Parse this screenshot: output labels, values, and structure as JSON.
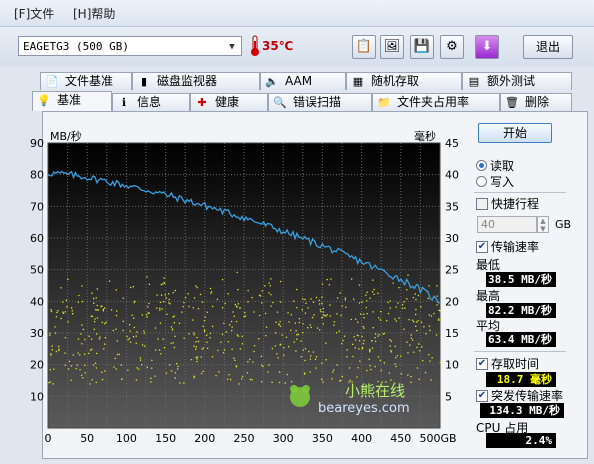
{
  "menu": {
    "file": "[F]文件",
    "help": "[H]帮助"
  },
  "drive": {
    "selected": "EAGETG3 (500 GB)"
  },
  "temperature": "35℃",
  "toolbar": {
    "exit_label": "退出"
  },
  "tabs_top": [
    {
      "label": "文件基准",
      "icon": "file-benchmark-icon"
    },
    {
      "label": "磁盘监视器",
      "icon": "disk-monitor-icon"
    },
    {
      "label": "AAM",
      "icon": "speaker-icon"
    },
    {
      "label": "随机存取",
      "icon": "random-access-icon"
    },
    {
      "label": "额外测试",
      "icon": "extra-tests-icon"
    }
  ],
  "tabs_bottom": [
    {
      "label": "基准",
      "icon": "lightbulb-icon"
    },
    {
      "label": "信息",
      "icon": "info-icon"
    },
    {
      "label": "健康",
      "icon": "health-cross-icon"
    },
    {
      "label": "错误扫描",
      "icon": "magnifier-icon"
    },
    {
      "label": "文件夹占用率",
      "icon": "folder-icon"
    },
    {
      "label": "删除",
      "icon": "trash-icon"
    }
  ],
  "chart_data": {
    "type": "line",
    "y_left_label": "MB/秒",
    "y_right_label": "毫秒",
    "ylim_left": [
      0,
      90
    ],
    "ylim_right": [
      0,
      45
    ],
    "xlim": [
      0,
      500
    ],
    "x_unit": "GB",
    "x_ticks": [
      "0",
      "50",
      "100",
      "150",
      "200",
      "250",
      "300",
      "350",
      "400",
      "450",
      "500GB"
    ],
    "y_left_ticks": [
      "10",
      "20",
      "30",
      "40",
      "50",
      "60",
      "70",
      "80",
      "90"
    ],
    "y_right_ticks": [
      "5",
      "10",
      "15",
      "20",
      "25",
      "30",
      "35",
      "40",
      "45"
    ],
    "grid": true,
    "series": [
      {
        "color": "#3a9fe0",
        "x": [
          0,
          10,
          20,
          30,
          40,
          50,
          60,
          70,
          80,
          90,
          100,
          110,
          120,
          130,
          140,
          150,
          160,
          170,
          180,
          190,
          200,
          210,
          220,
          230,
          240,
          250,
          260,
          270,
          280,
          290,
          300,
          310,
          320,
          330,
          340,
          350,
          360,
          370,
          380,
          390,
          400,
          410,
          420,
          430,
          440,
          450,
          460,
          470,
          480,
          490,
          500
        ],
        "y": [
          80.5,
          80.4,
          80.2,
          79.9,
          79.5,
          79.2,
          78.6,
          78.2,
          77.6,
          77.1,
          76.6,
          76.0,
          75.4,
          74.9,
          74.3,
          73.7,
          73.0,
          72.3,
          71.6,
          70.9,
          70.2,
          69.5,
          68.7,
          67.9,
          67.2,
          66.4,
          65.6,
          64.7,
          63.9,
          63.0,
          62.1,
          61.2,
          60.3,
          59.4,
          58.5,
          57.5,
          56.6,
          55.6,
          54.5,
          53.5,
          52.5,
          51.4,
          50.3,
          49.2,
          48.1,
          46.9,
          45.7,
          44.4,
          43.0,
          41.3,
          39.5
        ]
      }
    ],
    "scatter": {
      "color": "#e6e62a",
      "note_axis": "right",
      "ms_range": [
        7,
        25
      ],
      "ms_typical": 18.7
    },
    "watermark_site": "beareyes.com",
    "watermark_text": "小熊在线"
  },
  "controls": {
    "start_label": "开始",
    "read_label": "读取",
    "write_label": "写入",
    "short_stroke_label": "快捷行程",
    "short_stroke_value": "40",
    "short_stroke_unit": "GB",
    "transfer_rate_label": "传输速率",
    "min_label": "最低",
    "min_value": "38.5 MB/秒",
    "max_label": "最高",
    "max_value": "82.2 MB/秒",
    "avg_label": "平均",
    "avg_value": "63.4 MB/秒",
    "access_time_label": "存取时间",
    "access_time_value": "18.7 毫秒",
    "burst_label": "突发传输速率",
    "burst_value": "134.3 MB/秒",
    "cpu_label": "CPU 占用",
    "cpu_value": "2.4%"
  }
}
